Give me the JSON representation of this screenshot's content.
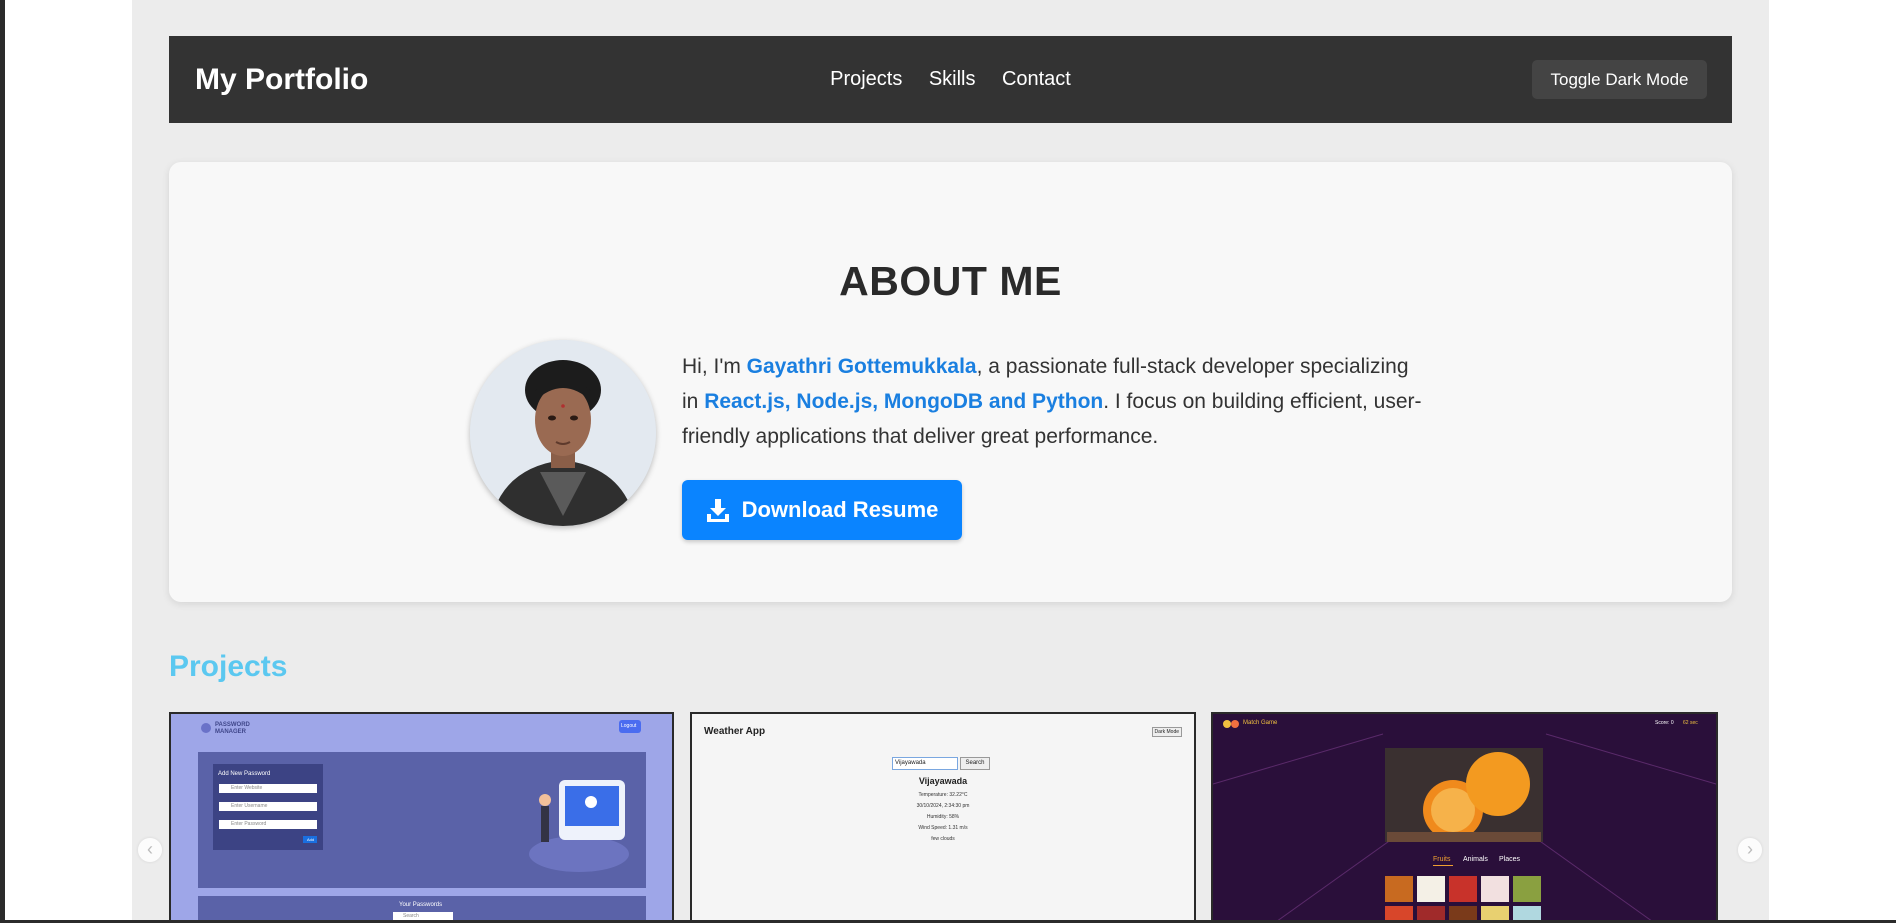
{
  "nav": {
    "brand": "My Portfolio",
    "links": [
      "Projects",
      "Skills",
      "Contact"
    ],
    "toggle_label": "Toggle Dark Mode"
  },
  "about": {
    "heading": "ABOUT ME",
    "bio_intro": "Hi, I'm ",
    "name": "Gayathri Gottemukkala",
    "bio_mid": ", a passionate full-stack developer specializing in ",
    "tech": "React.js, Node.js, MongoDB and Python",
    "bio_end": ". I focus on building efficient, user-friendly applications that deliver great performance.",
    "download_label": "Download Resume"
  },
  "projects": {
    "title": "Projects",
    "cards": [
      {
        "app": "PASSWORD MANAGER",
        "heading": "Add New Password",
        "fields": [
          "Enter Website",
          "Enter Username",
          "Enter Password"
        ],
        "add_label": "Add",
        "logout": "Logout",
        "list_heading": "Your Passwords",
        "search_placeholder": "Search"
      },
      {
        "app": "Weather App",
        "dark_mode": "Dark Mode",
        "input": "Vijayawada",
        "search": "Search",
        "city": "Vijayawada",
        "lines": [
          "Temperature: 32.22°C",
          "30/10/2024, 2:34:30 pm",
          "Humidity: 58%",
          "Wind Speed: 1.31 m/s",
          "few clouds"
        ]
      },
      {
        "app": "Match Game",
        "score": "Score: 0",
        "timer": "62 sec",
        "tabs": [
          "Fruits",
          "Animals",
          "Places"
        ]
      }
    ]
  },
  "colors": {
    "accent": "#0a84ff",
    "navbar": "#333333",
    "projects_title": "#5bc8f0"
  }
}
